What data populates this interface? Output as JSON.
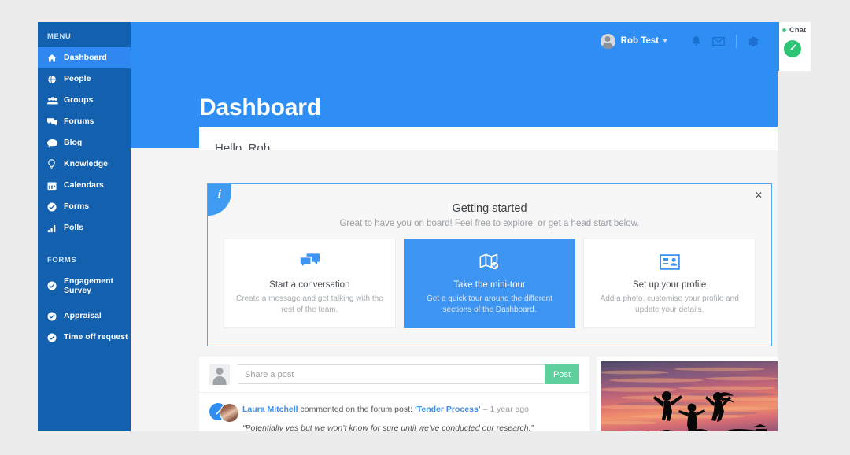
{
  "app": {
    "brand_blue": "#2f8ef4",
    "sidebar_blue": "#1360ae",
    "accent_green": "#5fcf9e"
  },
  "sidebar": {
    "menu_heading": "MENU",
    "items": [
      {
        "label": "Dashboard",
        "icon": "home-icon",
        "active": true
      },
      {
        "label": "People",
        "icon": "globe-icon",
        "active": false
      },
      {
        "label": "Groups",
        "icon": "group-icon",
        "active": false
      },
      {
        "label": "Forums",
        "icon": "forums-icon",
        "active": false
      },
      {
        "label": "Blog",
        "icon": "comment-icon",
        "active": false
      },
      {
        "label": "Knowledge",
        "icon": "lightbulb-icon",
        "active": false
      },
      {
        "label": "Calendars",
        "icon": "calendar-icon",
        "active": false
      },
      {
        "label": "Forms",
        "icon": "check-circle-icon",
        "active": false
      },
      {
        "label": "Polls",
        "icon": "bar-chart-icon",
        "active": false
      }
    ],
    "forms_heading": "FORMS",
    "forms": [
      {
        "label": "Engagement Survey",
        "icon": "check-circle-icon"
      },
      {
        "label": "Appraisal",
        "icon": "check-circle-icon"
      },
      {
        "label": "Time off request",
        "icon": "check-circle-icon"
      }
    ]
  },
  "header": {
    "page_title": "Dashboard",
    "user_name": "Rob Test",
    "icons": [
      "bell-icon",
      "envelope-icon",
      "gear-icon"
    ]
  },
  "hello": {
    "text": "Hello, Rob"
  },
  "getting_started": {
    "info_badge": "i",
    "close_label": "✕",
    "title": "Getting started",
    "subtitle": "Great to have you on board! Feel free to explore, or get a head start below.",
    "cards": [
      {
        "title": "Start a conversation",
        "desc": "Create a message and get talking with the rest of the team.",
        "icon": "chat-bubbles-icon",
        "featured": false
      },
      {
        "title": "Take the mini-tour",
        "desc": "Get a quick tour around the different sections of the Dashboard.",
        "icon": "map-check-icon",
        "featured": true
      },
      {
        "title": "Set up your profile",
        "desc": "Add a photo, customise your profile and update your details.",
        "icon": "id-card-icon",
        "featured": false
      }
    ]
  },
  "feed": {
    "share_placeholder": "Share a post",
    "share_value": "",
    "post_button": "Post",
    "items": [
      {
        "author": "Laura Mitchell",
        "action": " commented on the forum post: ",
        "target": "‘Tender Process’",
        "time": " – 1 year ago",
        "quote": "“Potentially yes but we won’t know for sure until we’ve conducted our research.”"
      }
    ]
  },
  "photo_card": {
    "alt": "Silhouettes of three people jumping against a pink and purple sunset sky"
  },
  "chat": {
    "label": "Chat",
    "status": "online",
    "compose_icon": "pencil-icon"
  }
}
